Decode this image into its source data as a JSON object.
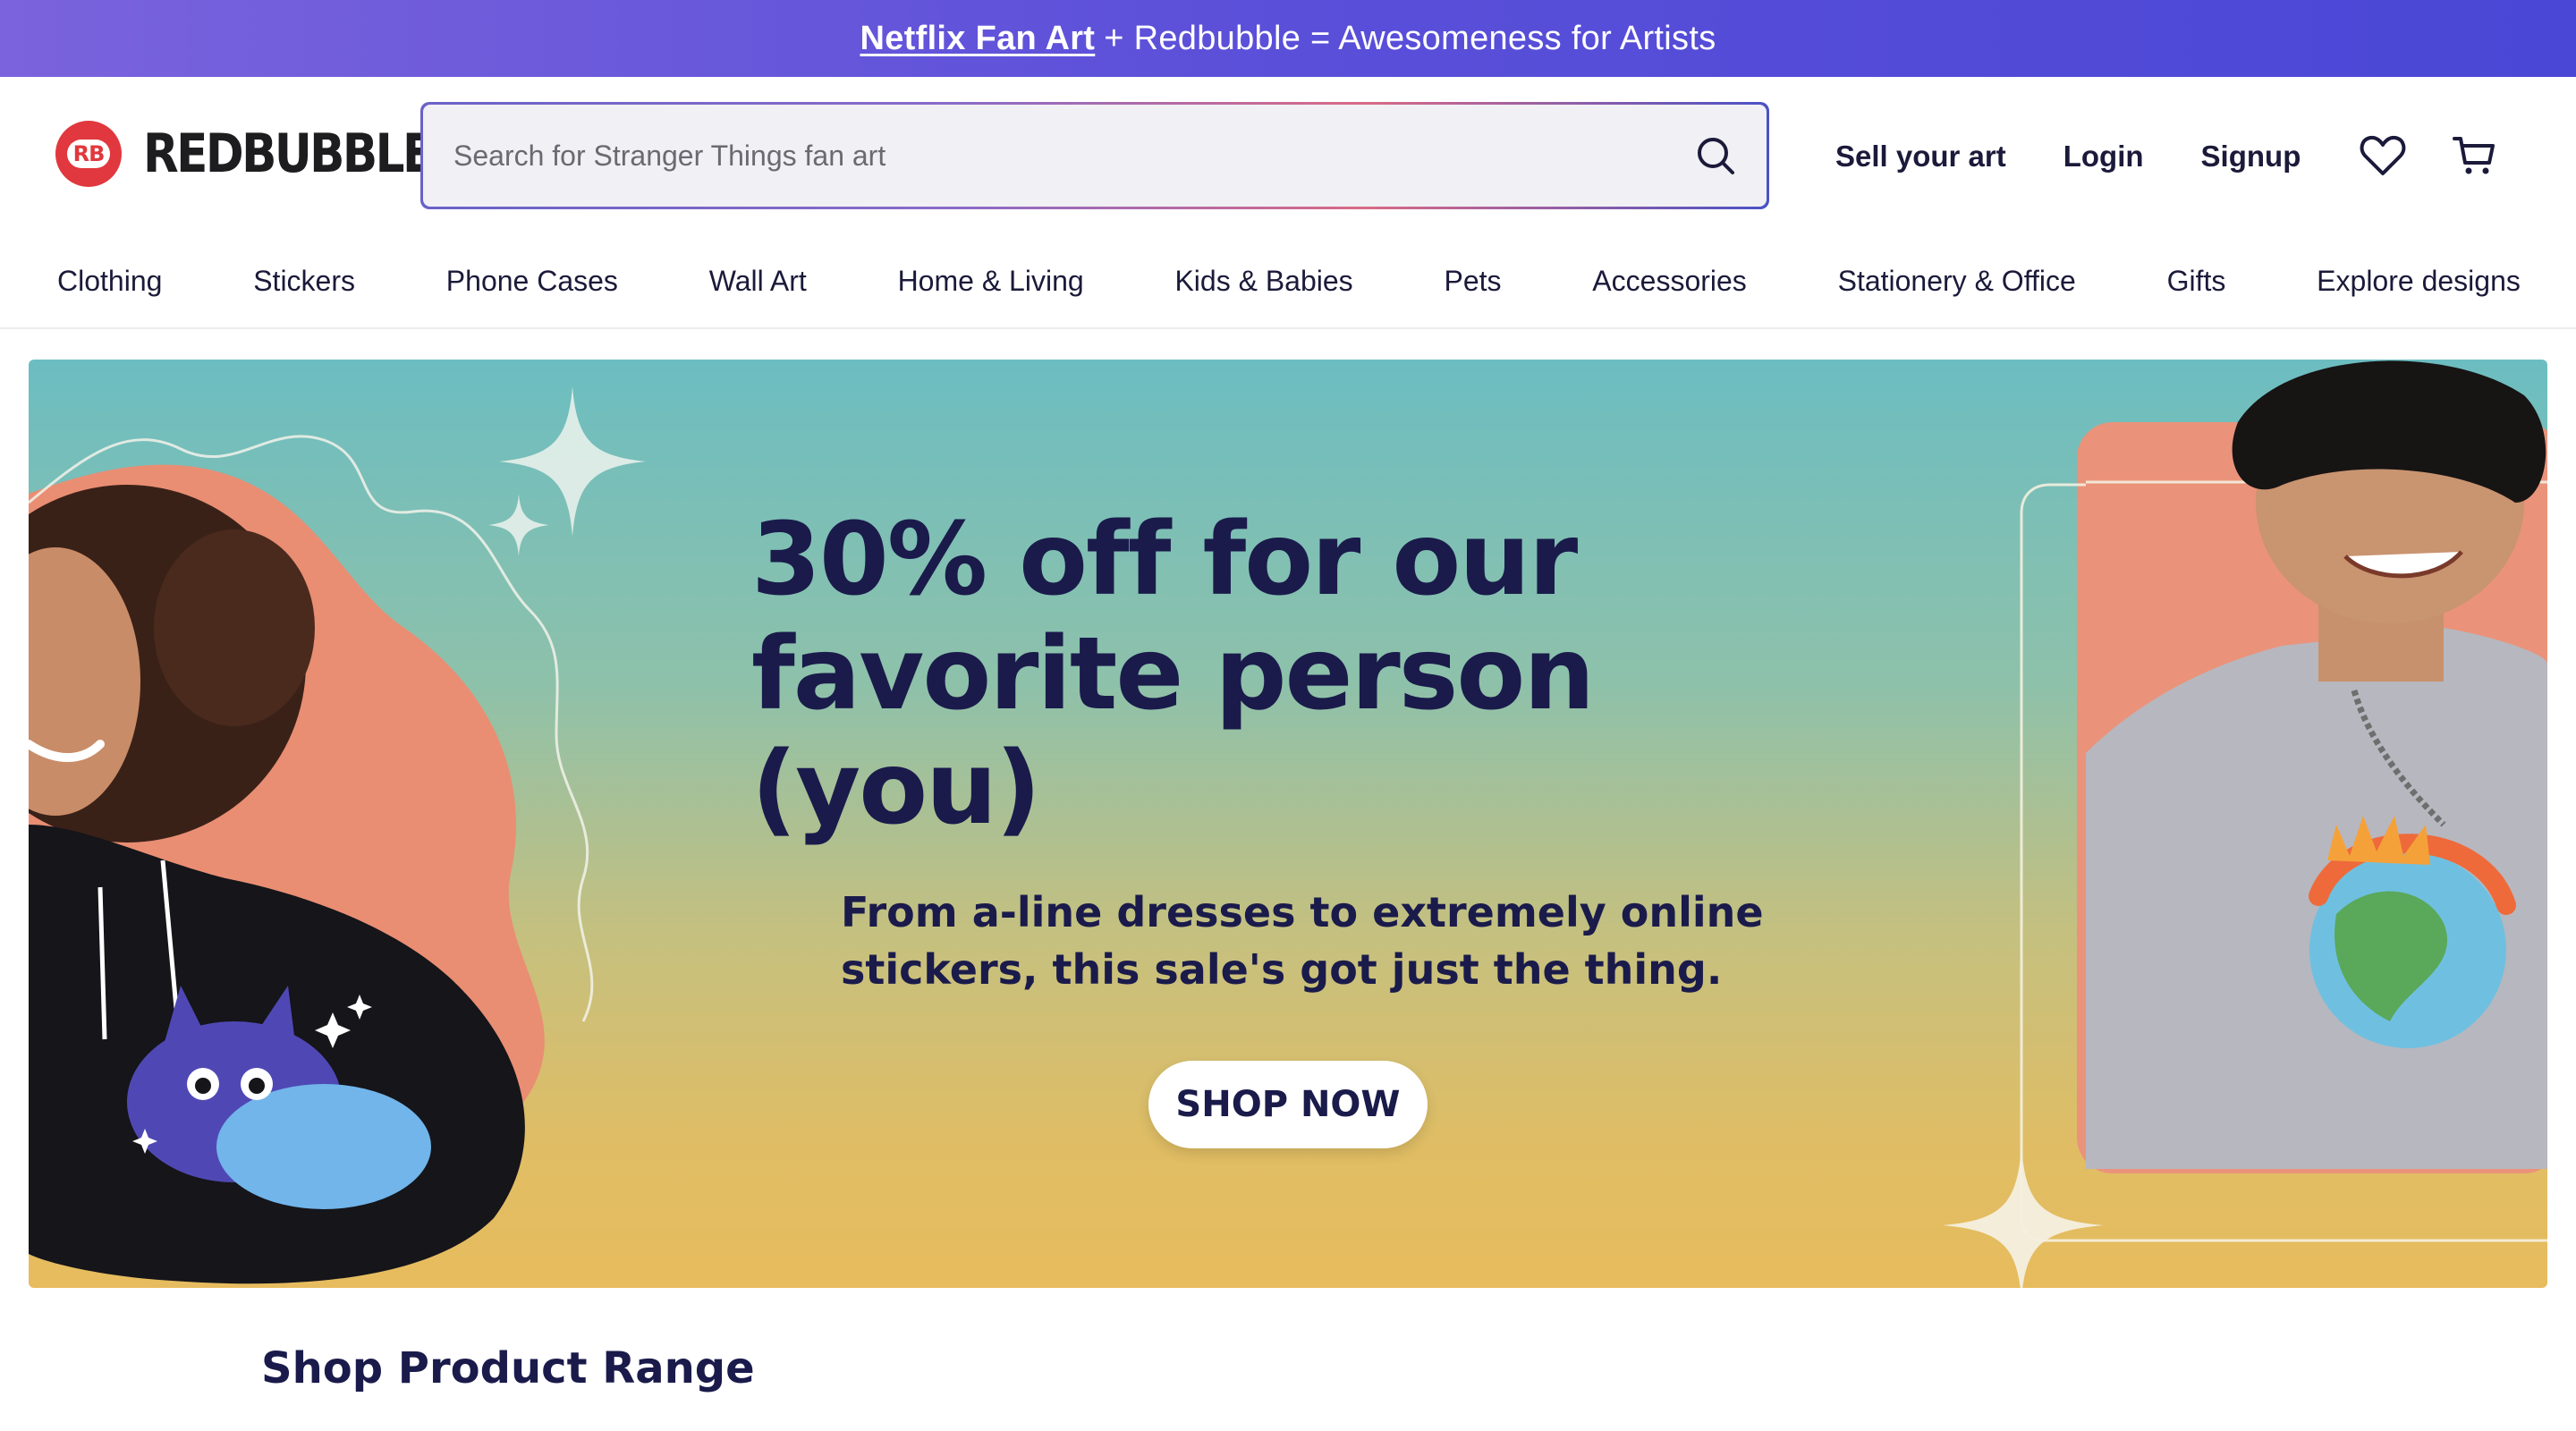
{
  "promo": {
    "link_text": "Netflix Fan Art",
    "rest_text": "+ Redbubble = Awesomeness for Artists"
  },
  "header": {
    "logo_text": "REDBUBBLE",
    "logo_mark": "RB",
    "search_placeholder": "Search for Stranger Things fan art",
    "links": [
      "Sell your art",
      "Login",
      "Signup"
    ],
    "icons": [
      "heart-icon",
      "cart-icon"
    ]
  },
  "nav": {
    "categories": [
      "Clothing",
      "Stickers",
      "Phone Cases",
      "Wall Art",
      "Home & Living",
      "Kids & Babies",
      "Pets",
      "Accessories",
      "Stationery & Office",
      "Gifts",
      "Explore designs"
    ]
  },
  "hero": {
    "title": "30% off for our favorite person (you)",
    "subtitle": "From a-line dresses to extremely online stickers, this sale's got just the thing.",
    "cta": "SHOP NOW"
  },
  "section": {
    "title": "Shop Product Range"
  },
  "colors": {
    "brand_red": "#e0383e",
    "promo_purple": "#5a4fd9",
    "navy_text": "#1a1b4b"
  }
}
